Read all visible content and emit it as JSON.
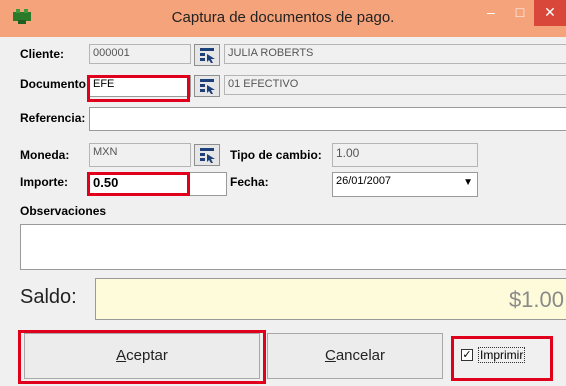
{
  "window": {
    "title": "Captura de documentos de pago.",
    "minimize": "‒",
    "maximize": "□",
    "close": "✕"
  },
  "cliente": {
    "label": "Cliente:",
    "code": "000001",
    "name": "JULIA ROBERTS"
  },
  "documento": {
    "label": "Documento:",
    "code": "EFE",
    "name": "01 EFECTIVO"
  },
  "referencia": {
    "label": "Referencia:",
    "value": ""
  },
  "moneda": {
    "label": "Moneda:",
    "code": "MXN"
  },
  "tipo_cambio": {
    "label": "Tipo de cambio:",
    "value": "1.00"
  },
  "importe": {
    "label": "Importe:",
    "value": "0.50"
  },
  "fecha": {
    "label": "Fecha:",
    "value": "26/01/2007",
    "arrow": "▼"
  },
  "observaciones": {
    "label": "Observaciones",
    "value": ""
  },
  "saldo": {
    "label": "Saldo:",
    "value": "$1.00"
  },
  "buttons": {
    "aceptar_accel": "A",
    "aceptar_rest": "ceptar",
    "cancelar_accel": "C",
    "cancelar_rest": "ancelar"
  },
  "imprimir": {
    "label": "Imprimir",
    "checked": "✓"
  },
  "colors": {
    "titlebar": "#f5a37a",
    "close": "#d9463a",
    "highlight": "#e0001b",
    "saldo_bg": "#fdfbd9"
  }
}
